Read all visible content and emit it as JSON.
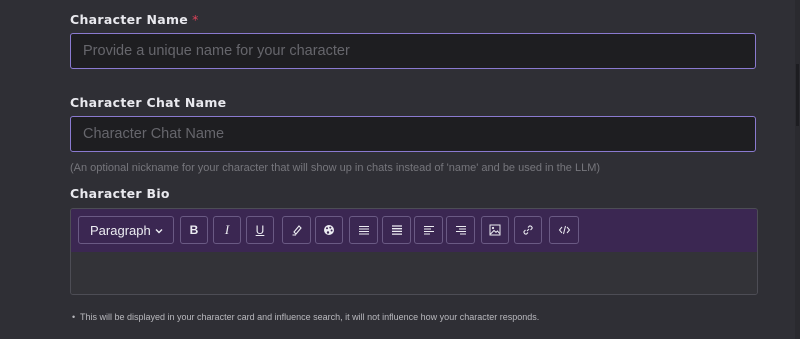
{
  "fields": {
    "name": {
      "label": "Character Name",
      "required_marker": "*",
      "placeholder": "Provide a unique name for your character",
      "value": ""
    },
    "chat_name": {
      "label": "Character Chat Name",
      "placeholder": "Character Chat Name",
      "value": "",
      "hint": "(An optional nickname for your character that will show up in chats instead of 'name' and be used in the LLM)"
    },
    "bio": {
      "label": "Character Bio",
      "note": "This will be displayed in your character card and influence search, it will not influence how your character responds."
    }
  },
  "toolbar": {
    "block_format": "Paragraph",
    "bold_label": "B",
    "italic_label": "I",
    "underline_label": "U",
    "icons": [
      "chevron-down-icon",
      "highlighter-icon",
      "palette-icon",
      "align-left-icon",
      "align-justify-icon",
      "align-left-icon",
      "align-right-icon",
      "image-icon",
      "link-icon",
      "code-icon"
    ]
  },
  "colors": {
    "background": "#2f2f35",
    "input_bg": "#1e1e21",
    "focus_border": "#8a7ad0",
    "toolbar_bg": "#3b2752",
    "required": "#e0435a"
  }
}
